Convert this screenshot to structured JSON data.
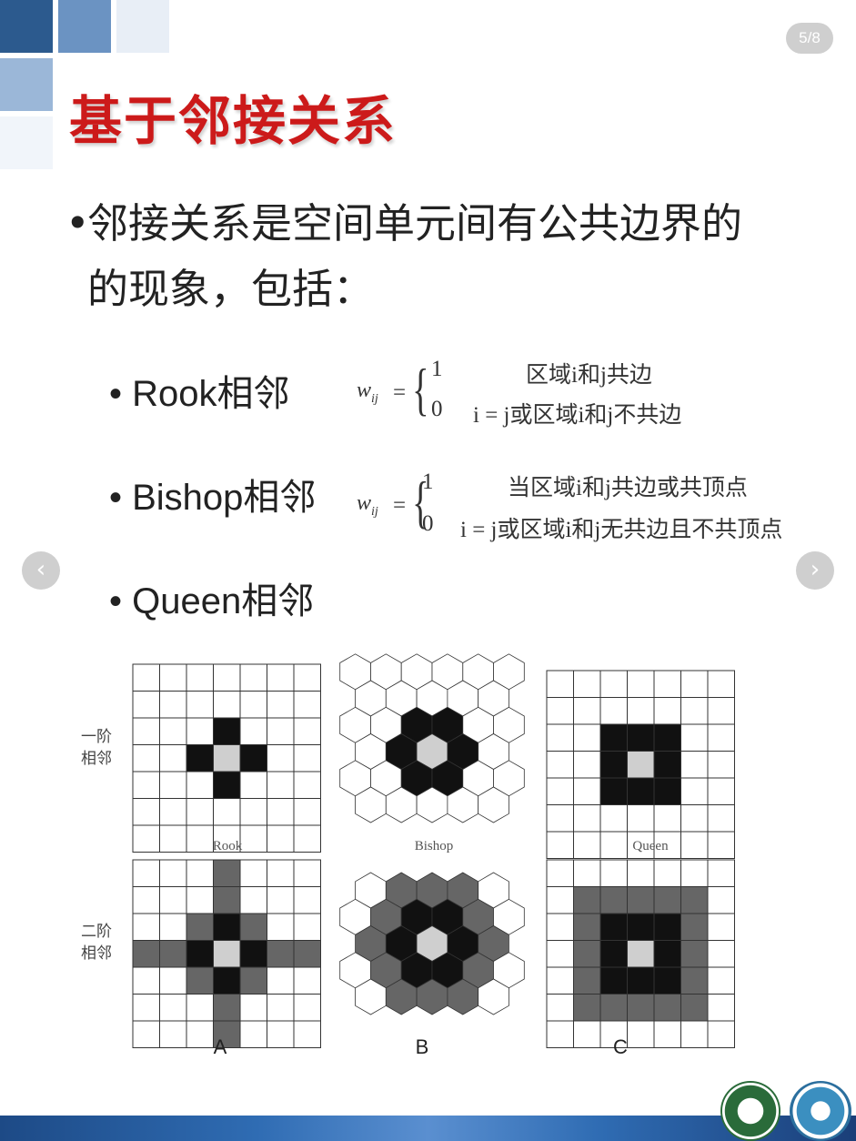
{
  "page_counter": "5/8",
  "title": "基于邻接关系",
  "bullet_main": {
    "dot": "•",
    "text": "邻接关系是空间单元间有公共边界的的现象，包括："
  },
  "rook": {
    "label": "• Rook相邻",
    "w": "w",
    "w_sub": "ij",
    "eq": "=",
    "row1_val": "1",
    "row1_cond": "区域i和j共边",
    "row2_val": "0",
    "row2_cond": "i = j或区域i和j不共边"
  },
  "bishop": {
    "label": "• Bishop相邻",
    "w": "w",
    "w_sub": "ij",
    "eq": "=",
    "row1_val": "1",
    "row1_cond": "当区域i和j共边或共顶点",
    "row2_val": "0",
    "row2_cond": "i = j或区域i和j无共边且不共顶点"
  },
  "queen": {
    "label": "• Queen相邻"
  },
  "nav": {
    "prev": "‹",
    "next": "›"
  },
  "figure": {
    "first_order_label": "一阶\n相邻",
    "second_order_label": "二阶\n相邻",
    "captions": {
      "rook": "Rook",
      "bishop": "Bishop",
      "queen": "Queen"
    },
    "letters": {
      "a": "A",
      "b": "B",
      "c": "C"
    },
    "colors": {
      "dark": "#111111",
      "mid": "#666666",
      "center": "#cfcfcf",
      "line": "#333333"
    }
  },
  "logos": {
    "left": "university-seal-icon",
    "right": "globe-emblem-icon"
  }
}
